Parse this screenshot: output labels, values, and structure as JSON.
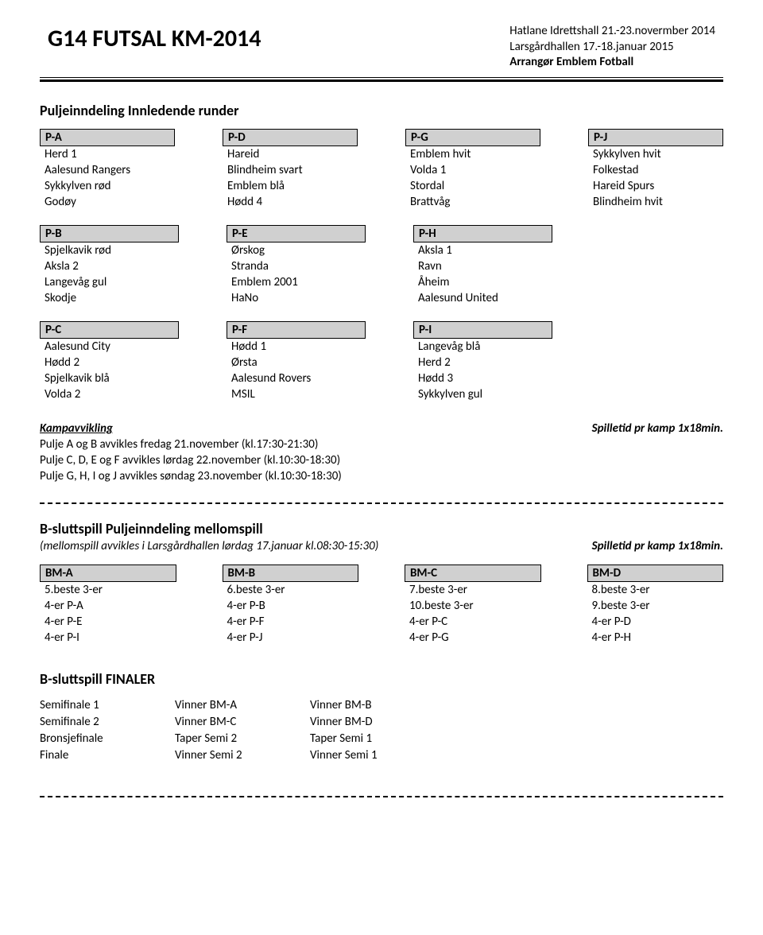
{
  "header": {
    "title": "G14 FUTSAL KM-2014",
    "line1": "Hatlane Idrettshall 21.-23.novermber 2014",
    "line2": "Larsgårdhallen 17.-18.januar 2015",
    "org": "Arrangør Emblem Fotball"
  },
  "section1": {
    "title": "Puljeinndeling Innledende runder",
    "rows": [
      [
        {
          "header": "P-A",
          "items": [
            "Herd 1",
            "Aalesund Rangers",
            "Sykkylven rød",
            "Godøy"
          ]
        },
        {
          "header": "P-D",
          "items": [
            "Hareid",
            "Blindheim svart",
            "Emblem blå",
            "Hødd 4"
          ]
        },
        {
          "header": "P-G",
          "items": [
            "Emblem hvit",
            "Volda 1",
            "Stordal",
            "Brattvåg"
          ]
        },
        {
          "header": "P-J",
          "items": [
            "Sykkylven hvit",
            "Folkestad",
            "Hareid Spurs",
            "Blindheim hvit"
          ]
        }
      ],
      [
        {
          "header": "P-B",
          "items": [
            "Spjelkavik rød",
            "Aksla 2",
            "Langevåg gul",
            "Skodje"
          ]
        },
        {
          "header": "P-E",
          "items": [
            "Ørskog",
            "Stranda",
            "Emblem 2001",
            "HaNo"
          ]
        },
        {
          "header": "P-H",
          "items": [
            "Aksla 1",
            "Ravn",
            "Åheim",
            "Aalesund United"
          ]
        }
      ],
      [
        {
          "header": "P-C",
          "items": [
            "Aalesund City",
            "Hødd 2",
            "Spjelkavik blå",
            "Volda 2"
          ]
        },
        {
          "header": "P-F",
          "items": [
            "Hødd 1",
            "Ørsta",
            "Aalesund Rovers",
            "MSIL"
          ]
        },
        {
          "header": "P-I",
          "items": [
            "Langevåg blå",
            "Herd 2",
            "Hødd 3",
            "Sykkylven gul"
          ]
        }
      ]
    ]
  },
  "kamp": {
    "label": "Kampavvikling",
    "note": "Spilletid pr kamp 1x18min.",
    "lines": [
      "Pulje A og B avvikles fredag 21.november (kl.17:30-21:30)",
      "Pulje C, D, E og F avvikles lørdag 22.november (kl.10:30-18:30)",
      "Pulje G, H, I og J avvikles søndag 23.november (kl.10:30-18:30)"
    ]
  },
  "section2": {
    "title": "B-sluttspill Puljeinndeling mellomspill",
    "sub": "(mellomspill avvikles i Larsgårdhallen lørdag 17.januar kl.08:30-15:30)",
    "note": "Spilletid pr kamp 1x18min.",
    "groups": [
      {
        "header": "BM-A",
        "items": [
          "5.beste 3-er",
          "4-er P-A",
          "4-er P-E",
          "4-er P-I"
        ]
      },
      {
        "header": "BM-B",
        "items": [
          "6.beste 3-er",
          "4-er P-B",
          "4-er P-F",
          "4-er P-J"
        ]
      },
      {
        "header": "BM-C",
        "items": [
          "7.beste 3-er",
          "10.beste 3-er",
          "4-er P-C",
          "4-er P-G"
        ]
      },
      {
        "header": "BM-D",
        "items": [
          "8.beste 3-er",
          "9.beste 3-er",
          "4-er P-D",
          "4-er P-H"
        ]
      }
    ]
  },
  "section3": {
    "title": "B-sluttspill FINALER",
    "rows": [
      {
        "c1": "Semifinale 1",
        "c2": "Vinner BM-A",
        "c3": "Vinner BM-B"
      },
      {
        "c1": "Semifinale 2",
        "c2": "Vinner BM-C",
        "c3": "Vinner BM-D"
      },
      {
        "c1": "Bronsjefinale",
        "c2": "Taper Semi 2",
        "c3": "Taper Semi 1"
      },
      {
        "c1": "Finale",
        "c2": "Vinner Semi 2",
        "c3": "Vinner Semi 1"
      }
    ]
  }
}
